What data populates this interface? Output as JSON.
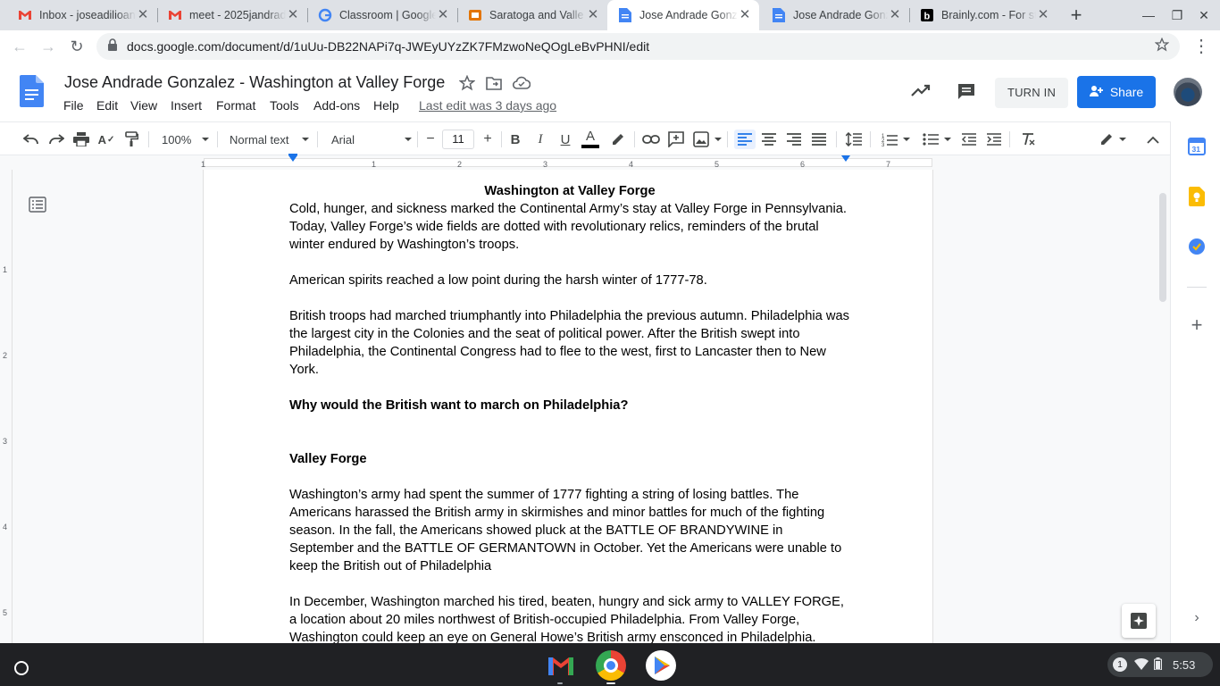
{
  "browser": {
    "tabs": [
      {
        "title": "Inbox - joseadilioan",
        "icon": "gmail-icon"
      },
      {
        "title": "meet - 2025jandrad",
        "icon": "gmail-icon"
      },
      {
        "title": "Classroom | Google",
        "icon": "google-icon"
      },
      {
        "title": "Saratoga and Valle",
        "icon": "slides-icon"
      },
      {
        "title": "Jose Andrade Gonz",
        "icon": "docs-icon",
        "active": true
      },
      {
        "title": "Jose Andrade Gonz",
        "icon": "docs-icon"
      },
      {
        "title": "Brainly.com - For st",
        "icon": "brainly-icon"
      }
    ],
    "new_tab": "+",
    "url": "docs.google.com/document/d/1uUu-DB22NAPi7q-JWEyUYzZK7FMzwoNeQOgLeBvPHNI/edit"
  },
  "docs": {
    "title": "Jose Andrade Gonzalez - Washington at Valley Forge",
    "menus": [
      "File",
      "Edit",
      "View",
      "Insert",
      "Format",
      "Tools",
      "Add-ons",
      "Help"
    ],
    "last_edit": "Last edit was 3 days ago",
    "turn_in": "TURN IN",
    "share": "Share",
    "toolbar": {
      "zoom": "100%",
      "style": "Normal text",
      "font": "Arial",
      "font_size": "11",
      "minus": "−",
      "plus": "+"
    },
    "ruler_numbers": [
      "1",
      "1",
      "2",
      "3",
      "4",
      "5",
      "6",
      "7"
    ],
    "vruler_numbers": [
      "1",
      "2",
      "3",
      "4",
      "5"
    ]
  },
  "document": {
    "heading": "Washington at Valley Forge",
    "p1": "Cold, hunger, and sickness marked the Continental Army’s stay at Valley Forge in Pennsylvania. Today, Valley Forge’s wide fields are dotted with revolutionary relics, reminders of the brutal winter endured by Washington’s troops.",
    "p2": "American spirits reached a low point during the harsh winter of 1777-78.",
    "p3": "British troops had marched triumphantly into Philadelphia the previous autumn. Philadelphia was the largest city in the Colonies and the seat of political power. After the British swept into Philadelphia, the Continental Congress had to flee to the west, first to Lancaster then to New York.",
    "q1": "Why would the British want to march on Philadelphia?",
    "h2": "Valley Forge",
    "p4": "Washington’s army had spent the summer of 1777 fighting a string of losing battles. The Americans harassed the British army in skirmishes and minor battles for much of the fighting season. In the fall, the Americans showed pluck at the BATTLE OF BRANDYWINE in September and the BATTLE OF GERMANTOWN in October. Yet the Americans were unable to keep the British out of Philadelphia",
    "p5": "In December, Washington marched his tired, beaten, hungry and sick army to VALLEY FORGE, a location about 20 miles northwest of British-occupied Philadelphia. From Valley Forge, Washington could keep an eye on General Howe’s British army ensconced in Philadelphia."
  },
  "shelf": {
    "notification_count": "1",
    "time": "5:53"
  },
  "colors": {
    "accent": "#1a73e8",
    "docs_blue": "#4285f4",
    "shelf": "#202124"
  }
}
